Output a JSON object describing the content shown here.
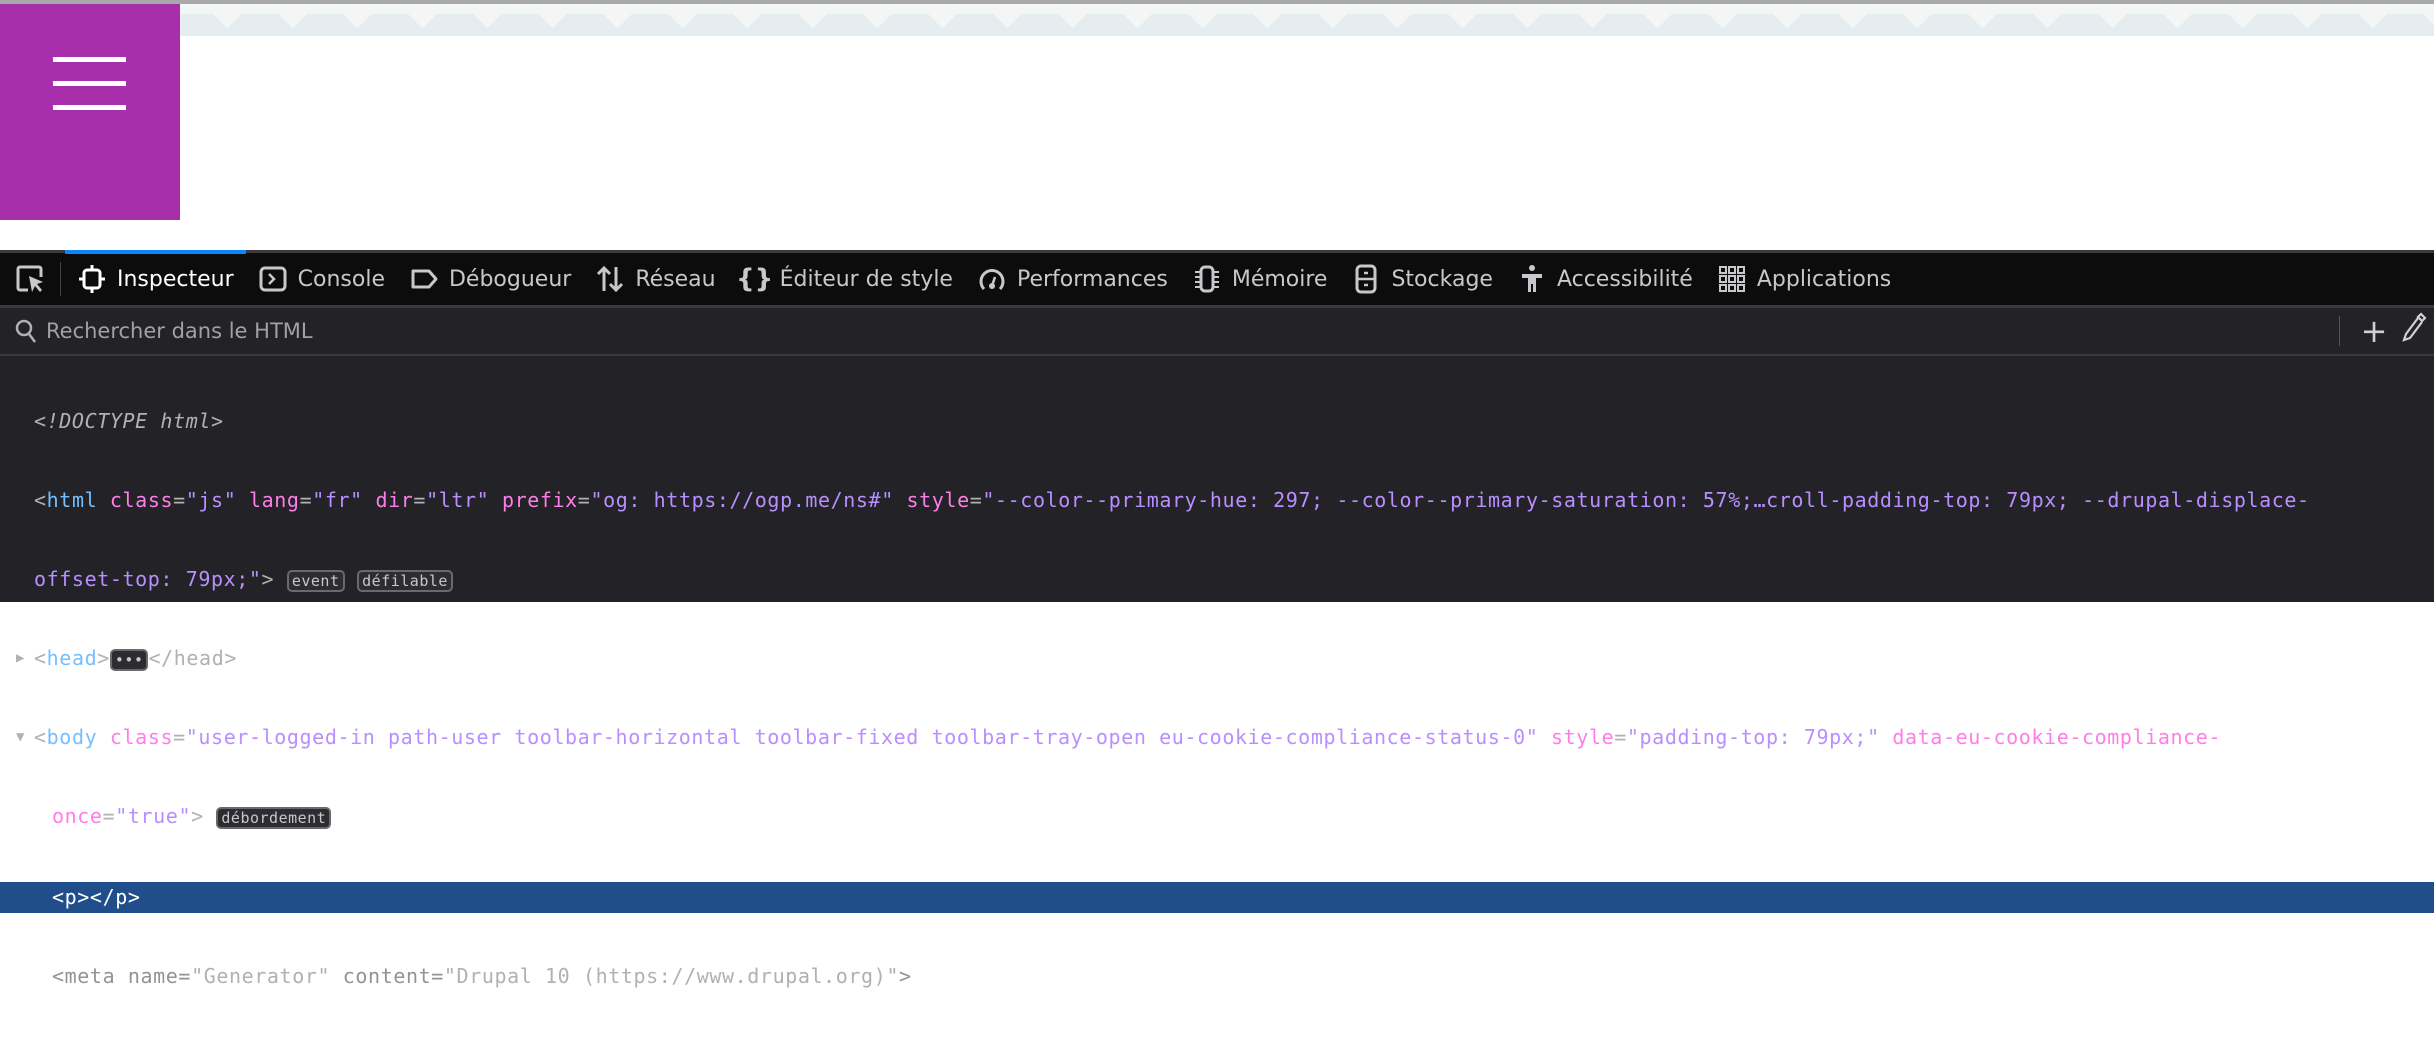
{
  "page": {
    "menu_icon": "hamburger-icon",
    "brand_color": "#a72fab"
  },
  "devtools": {
    "tabs": [
      {
        "label": "Inspecteur",
        "icon": "inspector-icon",
        "active": true
      },
      {
        "label": "Console",
        "icon": "console-icon"
      },
      {
        "label": "Débogueur",
        "icon": "debugger-icon"
      },
      {
        "label": "Réseau",
        "icon": "network-icon"
      },
      {
        "label": "Éditeur de style",
        "icon": "style-editor-icon"
      },
      {
        "label": "Performances",
        "icon": "performance-icon"
      },
      {
        "label": "Mémoire",
        "icon": "memory-icon"
      },
      {
        "label": "Stockage",
        "icon": "storage-icon"
      },
      {
        "label": "Accessibilité",
        "icon": "accessibility-icon"
      },
      {
        "label": "Applications",
        "icon": "applications-icon"
      }
    ],
    "search_placeholder": "Rechercher dans le HTML",
    "code": {
      "doctype": "<!DOCTYPE html>",
      "html_tag": "html",
      "html_attrs": [
        {
          "name": "class",
          "value": "\"js\""
        },
        {
          "name": "lang",
          "value": "\"fr\""
        },
        {
          "name": "dir",
          "value": "\"ltr\""
        },
        {
          "name": "prefix",
          "value": "\"og: https://ogp.me/ns#\""
        },
        {
          "name": "style",
          "value": "\"--color--primary-hue: 297; --color--primary-saturation: 57%;…croll-padding-top: 79px; --drupal-displace-"
        }
      ],
      "html_style_cont": "offset-top: 79px;\"",
      "html_badges": [
        "event",
        "défilable"
      ],
      "head_tag": "head",
      "head_close": "</head>",
      "body_tag": "body",
      "body_class": "\"user-logged-in path-user toolbar-horizontal toolbar-fixed toolbar-tray-open eu-cookie-compliance-status-0\"",
      "body_style": "\"padding-top: 79px;\"",
      "body_attr3_a": "data-eu-cookie-compliance-",
      "body_attr3_b": "once",
      "body_attr3_val": "\"true\"",
      "body_badge": "débordement",
      "selected": "<p></p>",
      "meta_name": "\"Generator\"",
      "meta_content": "\"Drupal 10 (https://www.drupal.org)\""
    }
  }
}
